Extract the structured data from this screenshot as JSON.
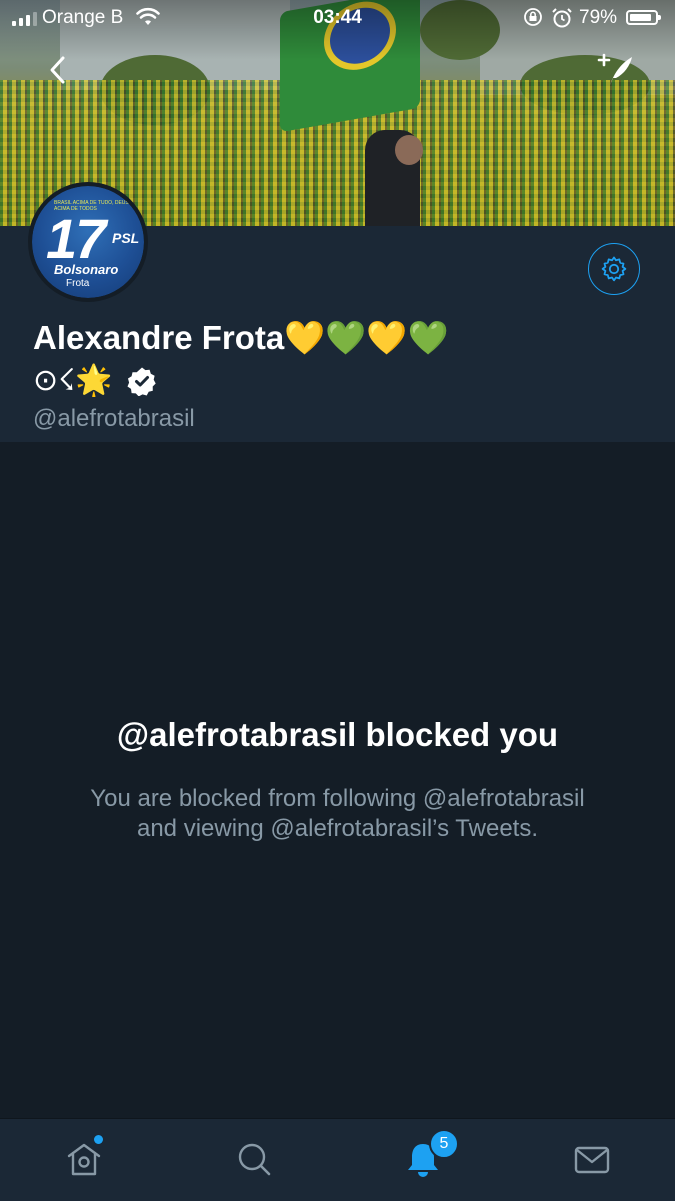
{
  "status_bar": {
    "carrier": "Orange B",
    "time": "03:44",
    "battery_percent": "79%",
    "signal_bars": 3
  },
  "profile": {
    "display_name": "Alexandre Frota💛💚💛💚",
    "bio_symbols": "⊙☇🌟",
    "verified": true,
    "handle": "@alefrotabrasil",
    "avatar_text": {
      "number": "17",
      "party": "PSL",
      "slogan": "Bolsonaro",
      "name": "Frota"
    }
  },
  "blocked": {
    "title": "@alefrotabrasil blocked you",
    "description_line1": "You are blocked from following @alefrotabrasil",
    "description_line2": "and viewing @alefrotabrasil’s Tweets."
  },
  "tabbar": {
    "notifications_badge": "5",
    "home_has_dot": true
  },
  "colors": {
    "background": "#141d26",
    "header_surface": "#1b2836",
    "accent": "#1da1f2",
    "secondary_text": "#8899a6"
  }
}
